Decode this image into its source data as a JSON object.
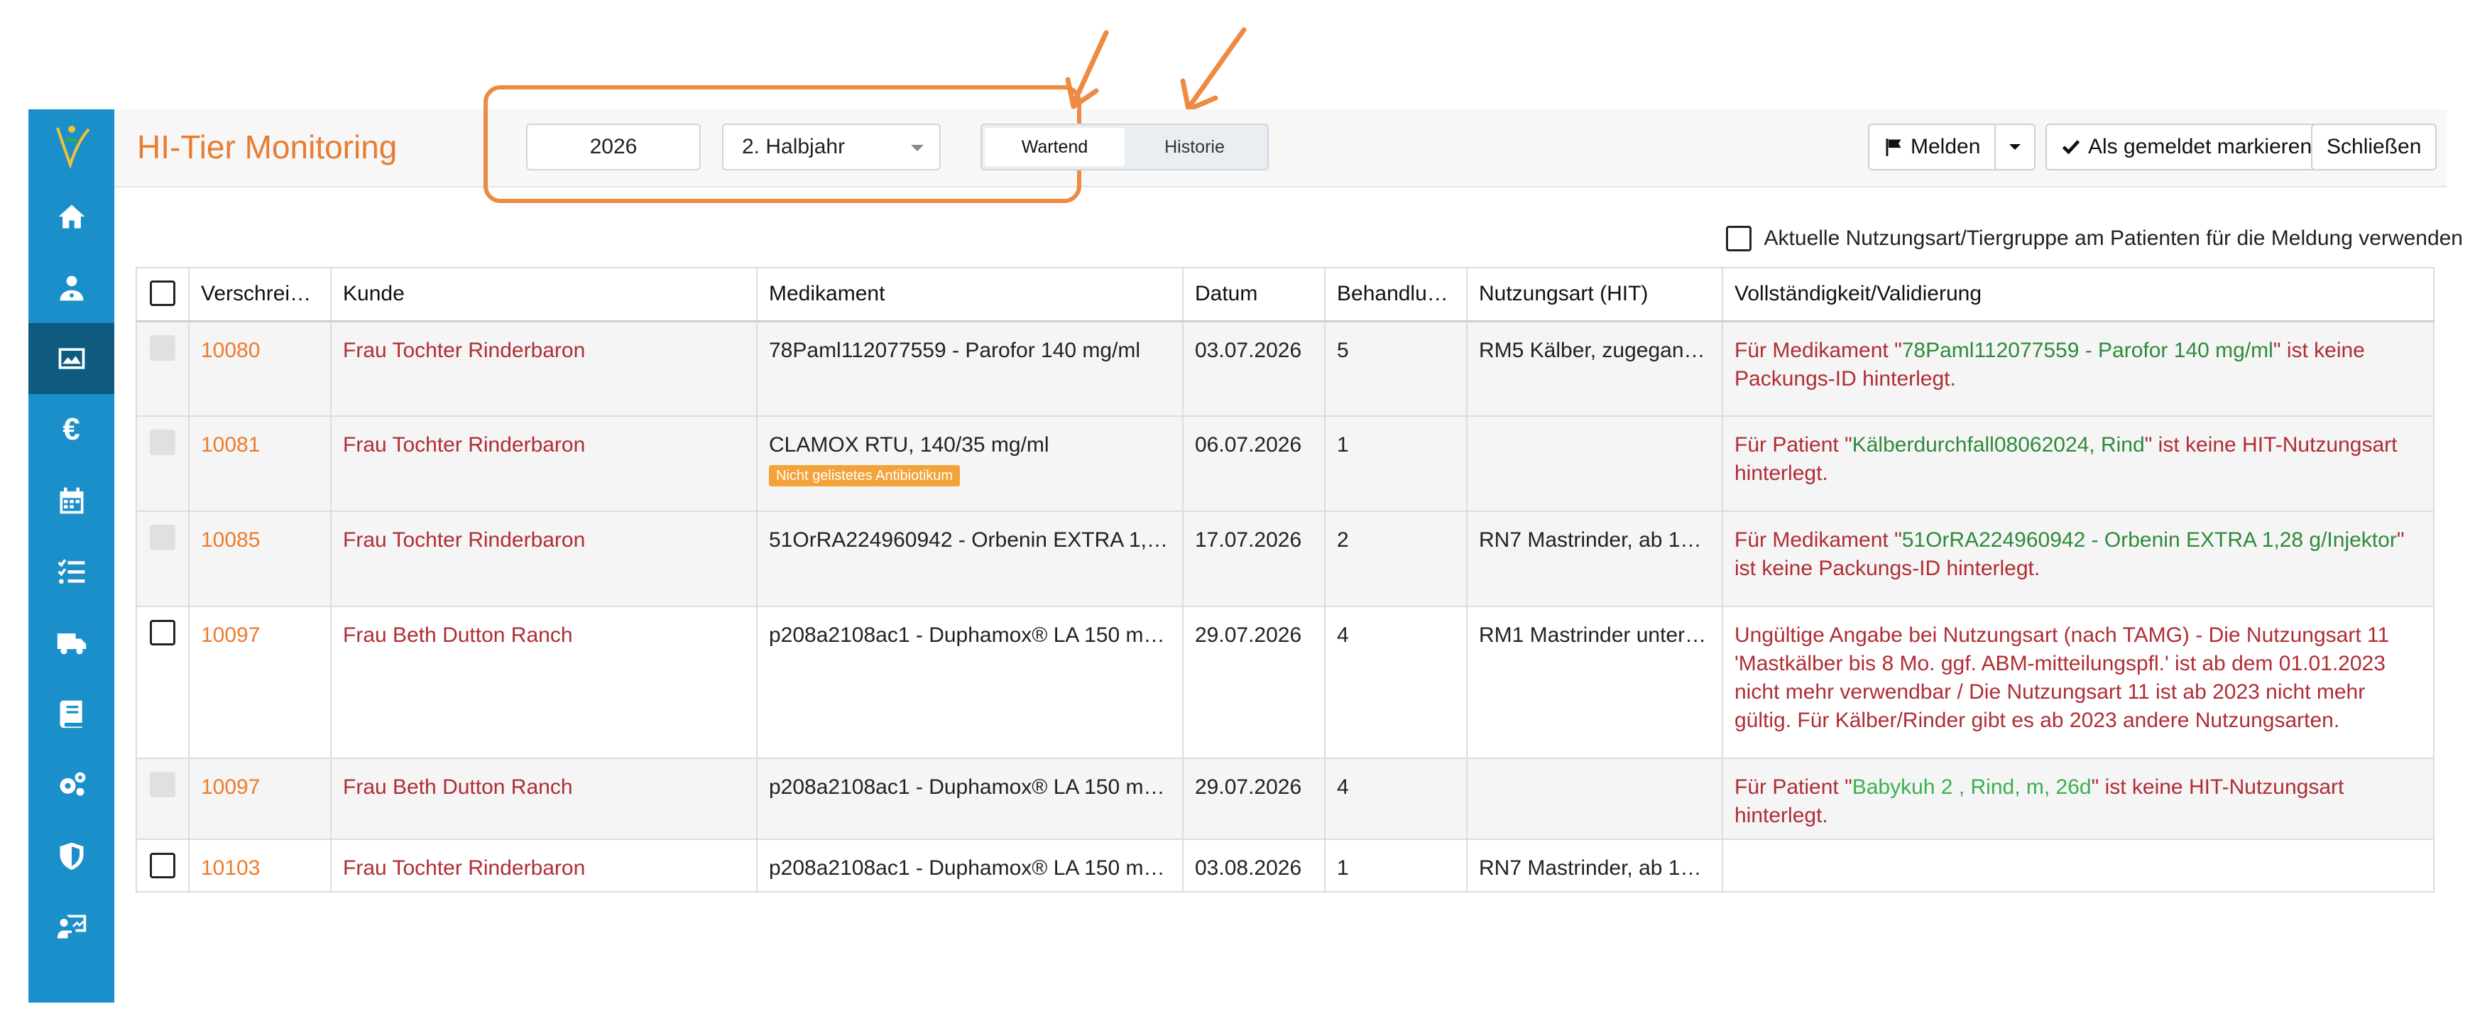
{
  "app": {
    "title": "HI-Tier Monitoring"
  },
  "filters": {
    "year": "2026",
    "period": "2. Halbjahr"
  },
  "tabs": {
    "waiting": "Wartend",
    "history": "Historie"
  },
  "toolbar": {
    "report": "Melden",
    "mark_reported": "Als gemeldet markieren",
    "close": "Schließen"
  },
  "option": {
    "use_current_label": "Aktuelle Nutzungsart/Tiergruppe am Patienten für die Meldung verwenden"
  },
  "table": {
    "headers": [
      "Verschreib…",
      "Kunde",
      "Medikament",
      "Datum",
      "Behandlun…",
      "Nutzungsart (HIT)",
      "Vollständigkeit/Validierung"
    ],
    "rows": [
      {
        "id": "10080",
        "customer": "Frau Tochter Rinderbaron",
        "drug": "78Paml112077559 - Parofor 140 mg/ml",
        "badge": "",
        "date": "03.07.2026",
        "count": "5",
        "usage": "RM5 Kälber, zugegangen…",
        "val_pre": "Für Medikament \"",
        "val_hl": "78Paml112077559 - Parofor 140 mg/ml",
        "val_post": "\" ist keine Packungs-ID hinterlegt."
      },
      {
        "id": "10081",
        "customer": "Frau Tochter Rinderbaron",
        "drug": "CLAMOX RTU, 140/35 mg/ml",
        "badge": "Nicht gelistetes Antibiotikum",
        "date": "06.07.2026",
        "count": "1",
        "usage": "",
        "val_pre": "Für Patient \"",
        "val_hl": "Kälberdurchfall08062024, Rind",
        "val_post": "\" ist keine HIT-Nutzungsart hinterlegt."
      },
      {
        "id": "10085",
        "customer": "Frau Tochter Rinderbaron",
        "drug": "51OrRA224960942 - Orbenin EXTRA 1,28 g/…",
        "badge": "",
        "date": "17.07.2026",
        "count": "2",
        "usage": "RN7 Mastrinder, ab 12 M…",
        "val_pre": "Für Medikament \"",
        "val_hl": "51OrRA224960942 - Orbenin EXTRA 1,28 g/Injektor",
        "val_post": "\" ist keine Packungs-ID hinterlegt."
      },
      {
        "id": "10097",
        "customer": "Frau Beth Dutton Ranch",
        "drug": "p208a2108ac1 - Duphamox® LA 150 mg/ml",
        "badge": "",
        "date": "29.07.2026",
        "count": "4",
        "usage": "RM1 Mastrinder unter 8 …",
        "val_pre": "Ungültige Angabe bei Nutzungsart (nach TAMG) - Die Nutzungsart 11 'Mastkälber bis 8 Mo. ggf. ABM-mitteilungspfl.' ist ab dem 01.01.2023 nicht mehr verwendbar / Die Nutzungsart 11 ist ab 2023 nicht mehr gültig. Für Kälber/Rinder gibt es ab 2023 andere Nutzungsarten.",
        "val_hl": "",
        "val_post": ""
      },
      {
        "id": "10097",
        "customer": "Frau Beth Dutton Ranch",
        "drug": "p208a2108ac1 - Duphamox® LA 150 mg/ml",
        "badge": "",
        "date": "29.07.2026",
        "count": "4",
        "usage": "",
        "val_pre": "Für Patient \"",
        "val_hl": "Babykuh 2 , Rind, m, 26d",
        "val_post": "\" ist keine HIT-Nutzungsart hinterlegt."
      },
      {
        "id": "10103",
        "customer": "Frau Tochter Rinderbaron",
        "drug": "p208a2108ac1 - Duphamox® LA 150 mg/ml",
        "badge": "",
        "date": "03.08.2026",
        "count": "1",
        "usage": "RN7 Mastrinder, ab 12 M…",
        "val_pre": "",
        "val_hl": "",
        "val_post": ""
      }
    ]
  },
  "colors": {
    "sidebar": "#1a8fc9",
    "sidebar_active": "#0f5b80",
    "accent_orange": "#ee7b2b",
    "error_red": "#b02d34",
    "highlight_green": "#2f8a3a",
    "badge_orange": "#f2a33a"
  },
  "icons": {
    "nav": [
      "home-icon",
      "user-doctor-icon",
      "chart-image-icon",
      "euro-icon",
      "calendar-icon",
      "checklist-icon",
      "truck-icon",
      "book-icon",
      "gears-icon",
      "shield-icon",
      "presentation-icon"
    ]
  }
}
